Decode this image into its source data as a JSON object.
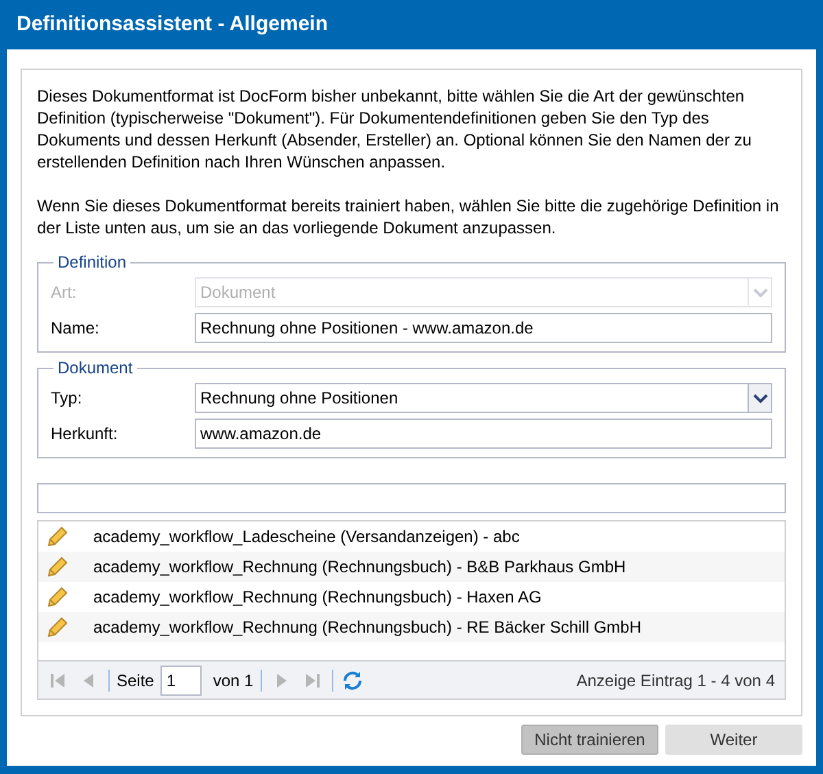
{
  "window": {
    "title": "Definitionsassistent - Allgemein"
  },
  "intro": [
    "Dieses Dokumentformat ist DocForm bisher unbekannt, bitte wählen Sie die Art der gewünschten Definition (typischerweise \"Dokument\"). Für Dokumentendefinitionen geben Sie den Typ des Dokuments und dessen Herkunft (Absender, Ersteller) an. Optional können Sie den Namen der zu erstellenden Definition nach Ihren Wünschen anpassen.",
    "Wenn Sie dieses Dokumentformat bereits trainiert haben, wählen Sie bitte die zugehörige Definition in der Liste unten aus, um sie an das vorliegende Dokument anzupassen."
  ],
  "fieldsets": [
    {
      "legend": "Definition",
      "fields": [
        {
          "label": "Art:",
          "kind": "select",
          "value": "Dokument",
          "disabled": true
        },
        {
          "label": "Name:",
          "kind": "text",
          "value": "Rechnung ohne Positionen - www.amazon.de",
          "disabled": false
        }
      ]
    },
    {
      "legend": "Dokument",
      "fields": [
        {
          "label": "Typ:",
          "kind": "select",
          "value": "Rechnung ohne Positionen",
          "disabled": false
        },
        {
          "label": "Herkunft:",
          "kind": "text",
          "value": "www.amazon.de",
          "disabled": false
        }
      ]
    }
  ],
  "list": {
    "rows": [
      {
        "text": "academy_workflow_Ladescheine (Versandanzeigen) - abc"
      },
      {
        "text": "academy_workflow_Rechnung (Rechnungsbuch) - B&B Parkhaus GmbH"
      },
      {
        "text": "academy_workflow_Rechnung (Rechnungsbuch) - Haxen AG"
      },
      {
        "text": "academy_workflow_Rechnung (Rechnungsbuch) - RE Bäcker Schill GmbH"
      }
    ],
    "pager": {
      "page_label": "Seite",
      "page": "1",
      "of": "von 1",
      "summary": "Anzeige Eintrag 1 - 4 von 4",
      "first_disabled": true,
      "prev_disabled": true,
      "next_disabled": true,
      "last_disabled": true
    }
  },
  "buttons": [
    {
      "label": "Nicht trainieren",
      "hovered": true
    },
    {
      "label": "Weiter",
      "hovered": false
    }
  ]
}
